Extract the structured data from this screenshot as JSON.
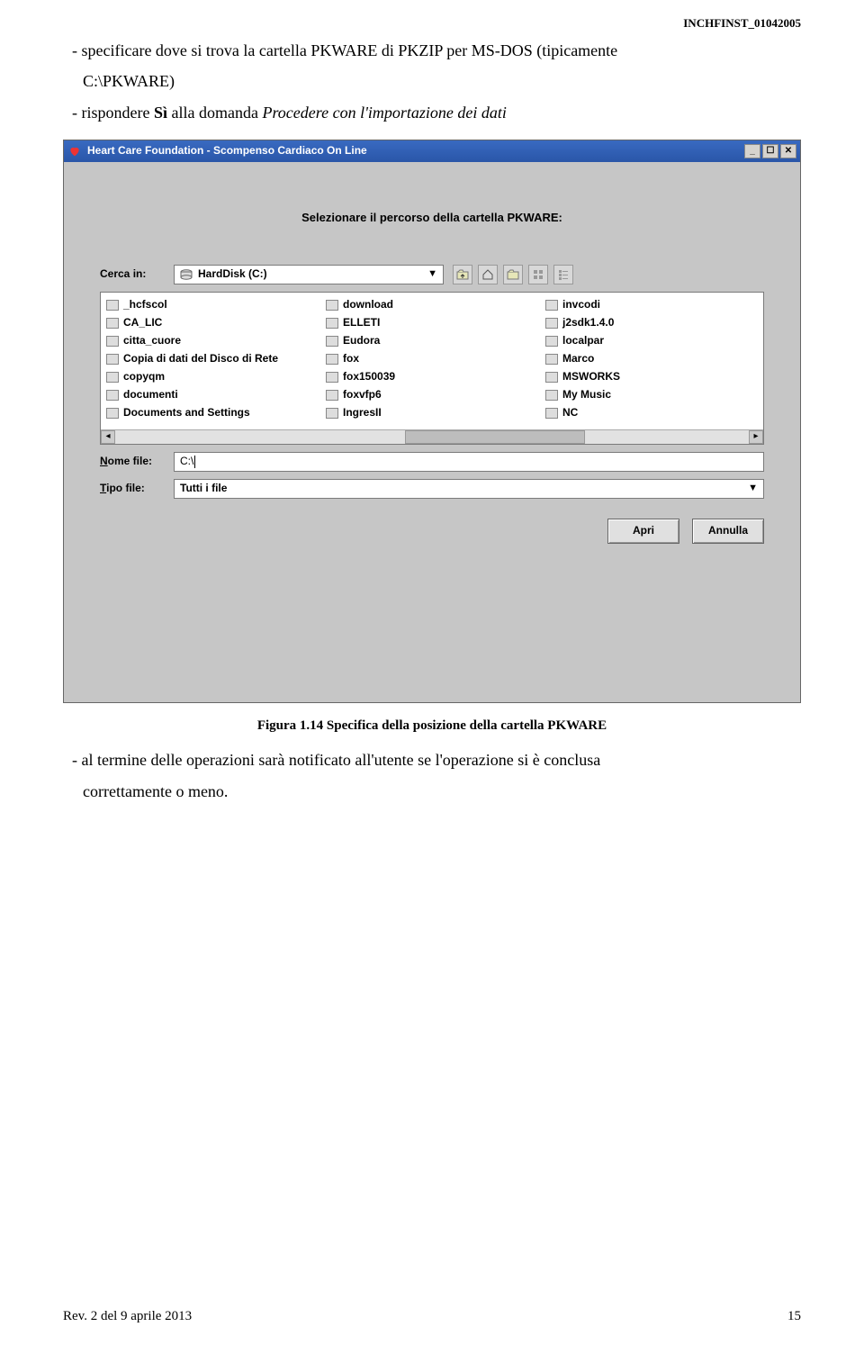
{
  "header": {
    "doc_id": "INCHFINST_01042005"
  },
  "body": {
    "bullet1_a": "- specificare dove si trova la cartella PKWARE di PKZIP per MS-DOS (tipicamente",
    "bullet1_b": "C:\\PKWARE)",
    "bullet2_a": "- rispondere ",
    "bullet2_b": "Sì",
    "bullet2_c": " alla domanda ",
    "bullet2_d": "Procedere con l'importazione dei dati"
  },
  "window": {
    "title": "Heart Care Foundation - Scompenso Cardiaco On Line",
    "prompt": "Selezionare il percorso della cartella PKWARE:",
    "search_label": "Cerca in:",
    "drive_selected": "HardDisk (C:)",
    "folders_col1": [
      "_hcfscol",
      "CA_LIC",
      "citta_cuore",
      "Copia di dati del Disco di Rete",
      "copyqm",
      "documenti",
      "Documents and Settings"
    ],
    "folders_col2": [
      "download",
      "ELLETI",
      "Eudora",
      "fox",
      "fox150039",
      "foxvfp6",
      "IngresII"
    ],
    "folders_col3": [
      "invcodi",
      "j2sdk1.4.0",
      "localpar",
      "Marco",
      "MSWORKS",
      "My Music",
      "NC"
    ],
    "filename_label": "Nome file:",
    "filename_value": "C:\\",
    "filetype_label": "Tipo file:",
    "filetype_value": "Tutti i file",
    "open_btn": "Apri",
    "cancel_btn": "Annulla"
  },
  "caption": "Figura 1.14 Specifica della posizione della cartella PKWARE",
  "after": {
    "bullet3": "- al termine delle operazioni sarà notificato all'utente se l'operazione si è conclusa",
    "bullet3b": "correttamente o meno."
  },
  "footer": {
    "left": "Rev. 2 del 9 aprile 2013",
    "right": "15"
  }
}
